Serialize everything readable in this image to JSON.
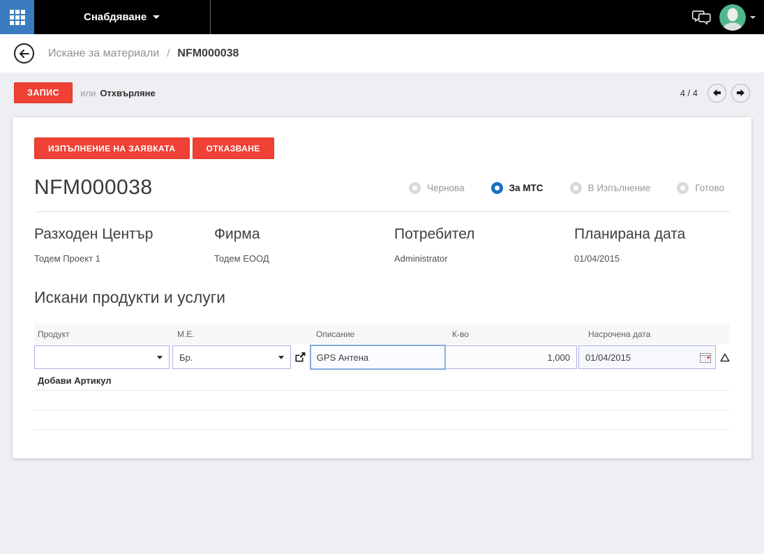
{
  "topbar": {
    "menu_label": "Снабдяване"
  },
  "breadcrumb": {
    "section": "Искане за материали",
    "separator": "/",
    "current": "NFM000038"
  },
  "toolbar": {
    "save": "ЗАПИС",
    "or": "или",
    "discard": "Отхвърляне",
    "pager_count": "4 / 4"
  },
  "card": {
    "actions": {
      "execute": "ИЗПЪЛНЕНИЕ НА ЗАЯВКАТА",
      "cancel": "ОТКАЗВАНЕ"
    },
    "title": "NFM000038",
    "statuses": [
      {
        "label": "Чернова",
        "selected": false
      },
      {
        "label": "За МТС",
        "selected": true
      },
      {
        "label": "В Изпълнение",
        "selected": false
      },
      {
        "label": "Готово",
        "selected": false
      }
    ],
    "fields": [
      {
        "label": "Разходен Център",
        "value": "Тодем Проект 1"
      },
      {
        "label": "Фирма",
        "value": "Тодем ЕООД"
      },
      {
        "label": "Потребител",
        "value": "Administrator"
      },
      {
        "label": "Планирана дата",
        "value": "01/04/2015"
      }
    ],
    "lines": {
      "section_title": "Искани продукти и услуги",
      "columns": [
        "Продукт",
        "М.Е.",
        "Описание",
        "К-во",
        "Насрочена дата"
      ],
      "row": {
        "product": "",
        "uom": "Бр.",
        "description": "GPS Антена",
        "quantity": "1,000",
        "date": "01/04/2015"
      },
      "add_item": "Добави Артикул"
    }
  },
  "colors": {
    "accent_red": "#ef4136",
    "apps_blue": "#3b7bbf",
    "radio_selected_blue": "#1a6fc5",
    "avatar_green": "#50b78c",
    "page_bg": "#edeff2"
  },
  "icons": {
    "apps": "apps-grid",
    "chat": "chat-bubbles",
    "menu_caret": "▾",
    "avatar_caret": "▾",
    "back": "←",
    "prev": "◀",
    "next": "▶",
    "select_caret": "▾",
    "share": "share-out",
    "calendar": "calendar",
    "warning": "⚠"
  }
}
